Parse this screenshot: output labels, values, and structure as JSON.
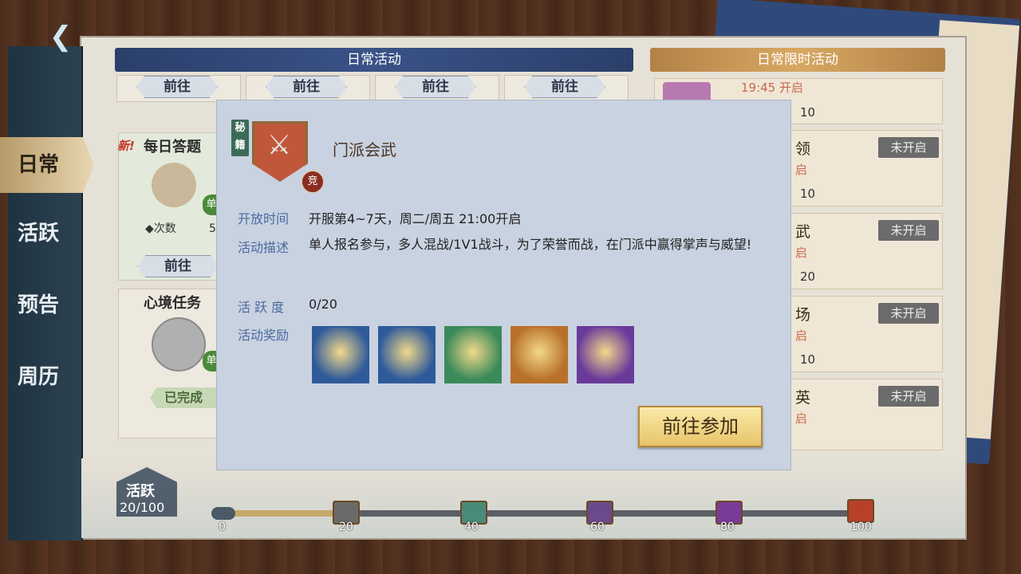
{
  "nav": {
    "back_icon": "back-arrow-icon",
    "items": [
      {
        "label": "日常",
        "active": true
      },
      {
        "label": "活跃",
        "active": false
      },
      {
        "label": "预告",
        "active": false
      },
      {
        "label": "周历",
        "active": false
      }
    ]
  },
  "daily": {
    "header": "日常活动",
    "goto_label": "前往",
    "cards": [
      {
        "new_badge": "新!",
        "title": "每日答题",
        "count_label": "◆次数",
        "count_value": "5",
        "badge": "单",
        "action": "前往"
      },
      {
        "title": "心境任务",
        "badge": "单",
        "action": "已完成"
      }
    ]
  },
  "limited": {
    "header": "日常限时活动",
    "items": [
      {
        "name": "",
        "time": "19:45 开启",
        "points": "10",
        "status": ""
      },
      {
        "name": "领",
        "time": "启",
        "points": "10",
        "status": "未开启"
      },
      {
        "name": "武",
        "time": "启",
        "points": "20",
        "status": "未开启"
      },
      {
        "name": "场",
        "time": "启",
        "points": "10",
        "status": "未开启"
      },
      {
        "name": "英",
        "time": "启",
        "points": "",
        "status": "未开启"
      }
    ]
  },
  "activity": {
    "label": "活跃",
    "value": "20/100",
    "progress": 0.2,
    "milestones": [
      "0",
      "20",
      "40",
      "60",
      "80",
      "100"
    ]
  },
  "modal": {
    "tag": "秘籍",
    "emblem_icon": "crossed-swords-icon",
    "competitive_badge": "竞",
    "title": "门派会武",
    "open_time_label": "开放时间",
    "open_time": "开服第4~7天，周二/周五 21:00开启",
    "desc_label": "活动描述",
    "desc": "单人报名参与，多人混战/1V1战斗，为了荣誉而战，在门派中赢得掌声与威望!",
    "activity_label": "活 跃 度",
    "activity_value": "0/20",
    "reward_label": "活动奖励",
    "rewards": [
      {
        "icon": "golden-swirl-icon",
        "color": "#2f5a9a"
      },
      {
        "icon": "golden-orb-icon",
        "color": "#2f5a9a"
      },
      {
        "icon": "green-crystal-icon",
        "color": "#3a8a5a"
      },
      {
        "icon": "secret-book-icon",
        "color": "#b8702a"
      },
      {
        "icon": "moon-ring-icon",
        "color": "#6a3a9a"
      }
    ],
    "go_button": "前往参加"
  }
}
